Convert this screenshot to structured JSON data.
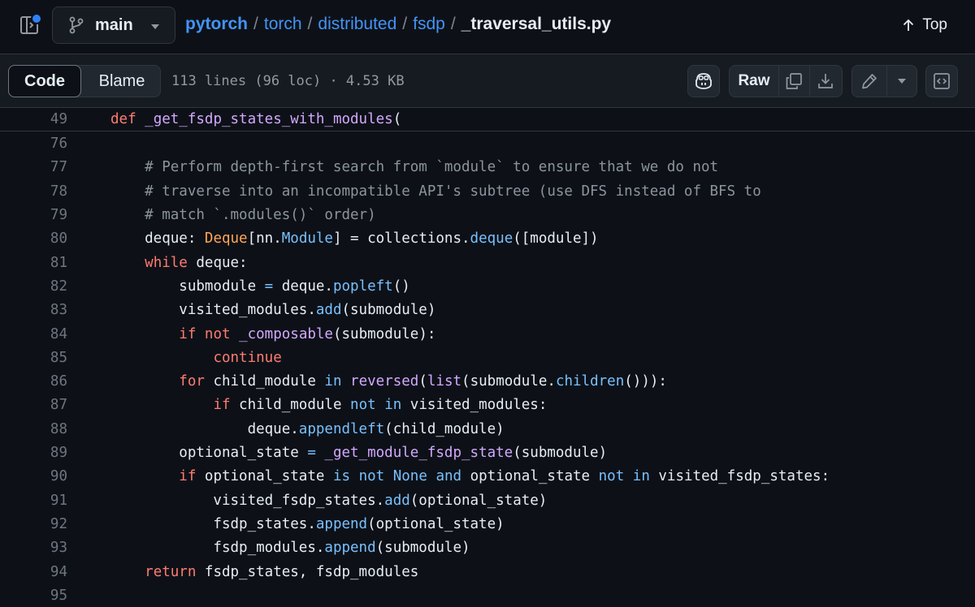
{
  "repo": {
    "branch": "main",
    "breadcrumb": [
      "pytorch",
      "torch",
      "distributed",
      "fsdp"
    ],
    "file_name": "_traversal_utils.py",
    "top_link": "Top"
  },
  "file_header": {
    "tabs": [
      "Code",
      "Blame"
    ],
    "active_tab": "Code",
    "meta": "113 lines (96 loc) · 4.53 KB",
    "raw_label": "Raw"
  },
  "colors": {
    "keyword": "#ff7b72",
    "function": "#d2a8ff",
    "method": "#79c0ff",
    "comment": "#8b949e",
    "type": "#ffa657",
    "link": "#4493f8",
    "notification_dot": "#2f81f7"
  },
  "icons": {
    "sidebar_toggle": "sidebar-expand-icon",
    "branch": "git-branch-icon",
    "top": "arrow-up-icon",
    "copilot": "copilot-icon",
    "copy": "copy-icon",
    "download": "download-icon",
    "edit": "pencil-icon",
    "edit_menu": "triangle-down-icon",
    "symbols": "code-square-icon"
  },
  "code": {
    "sticky": {
      "number": "49",
      "tokens": [
        {
          "t": "def",
          "c": "kw"
        },
        {
          "t": " ",
          "c": ""
        },
        {
          "t": "_get_fsdp_states_with_modules",
          "c": "fn"
        },
        {
          "t": "(",
          "c": ""
        }
      ]
    },
    "lines": [
      {
        "number": "76",
        "tokens": []
      },
      {
        "number": "77",
        "tokens": [
          {
            "t": "    # Perform depth-first search from `module` to ensure that we do not",
            "c": "cm"
          }
        ]
      },
      {
        "number": "78",
        "tokens": [
          {
            "t": "    # traverse into an incompatible API's subtree (use DFS instead of BFS to",
            "c": "cm"
          }
        ]
      },
      {
        "number": "79",
        "tokens": [
          {
            "t": "    # match `.modules()` order)",
            "c": "cm"
          }
        ]
      },
      {
        "number": "80",
        "tokens": [
          {
            "t": "    deque: ",
            "c": ""
          },
          {
            "t": "Deque",
            "c": "ty"
          },
          {
            "t": "[nn.",
            "c": ""
          },
          {
            "t": "Module",
            "c": "mt"
          },
          {
            "t": "] = collections.",
            "c": ""
          },
          {
            "t": "deque",
            "c": "mt"
          },
          {
            "t": "([module])",
            "c": ""
          }
        ]
      },
      {
        "number": "81",
        "tokens": [
          {
            "t": "    ",
            "c": ""
          },
          {
            "t": "while",
            "c": "kw"
          },
          {
            "t": " deque:",
            "c": ""
          }
        ]
      },
      {
        "number": "82",
        "tokens": [
          {
            "t": "        submodule ",
            "c": ""
          },
          {
            "t": "=",
            "c": "mt"
          },
          {
            "t": " deque.",
            "c": ""
          },
          {
            "t": "popleft",
            "c": "mt"
          },
          {
            "t": "()",
            "c": ""
          }
        ]
      },
      {
        "number": "83",
        "tokens": [
          {
            "t": "        visited_modules.",
            "c": ""
          },
          {
            "t": "add",
            "c": "mt"
          },
          {
            "t": "(submodule)",
            "c": ""
          }
        ]
      },
      {
        "number": "84",
        "tokens": [
          {
            "t": "        ",
            "c": ""
          },
          {
            "t": "if",
            "c": "kw"
          },
          {
            "t": " ",
            "c": ""
          },
          {
            "t": "not",
            "c": "kw"
          },
          {
            "t": " ",
            "c": ""
          },
          {
            "t": "_composable",
            "c": "fn"
          },
          {
            "t": "(submodule):",
            "c": ""
          }
        ]
      },
      {
        "number": "85",
        "tokens": [
          {
            "t": "            ",
            "c": ""
          },
          {
            "t": "continue",
            "c": "kw"
          }
        ]
      },
      {
        "number": "86",
        "tokens": [
          {
            "t": "        ",
            "c": ""
          },
          {
            "t": "for",
            "c": "kw"
          },
          {
            "t": " child_module ",
            "c": ""
          },
          {
            "t": "in",
            "c": "mt"
          },
          {
            "t": " ",
            "c": ""
          },
          {
            "t": "reversed",
            "c": "fn"
          },
          {
            "t": "(",
            "c": ""
          },
          {
            "t": "list",
            "c": "fn"
          },
          {
            "t": "(submodule.",
            "c": ""
          },
          {
            "t": "children",
            "c": "mt"
          },
          {
            "t": "())):",
            "c": ""
          }
        ]
      },
      {
        "number": "87",
        "tokens": [
          {
            "t": "            ",
            "c": ""
          },
          {
            "t": "if",
            "c": "kw"
          },
          {
            "t": " child_module ",
            "c": ""
          },
          {
            "t": "not",
            "c": "mt"
          },
          {
            "t": " ",
            "c": ""
          },
          {
            "t": "in",
            "c": "mt"
          },
          {
            "t": " visited_modules:",
            "c": ""
          }
        ]
      },
      {
        "number": "88",
        "tokens": [
          {
            "t": "                deque.",
            "c": ""
          },
          {
            "t": "appendleft",
            "c": "mt"
          },
          {
            "t": "(child_module)",
            "c": ""
          }
        ]
      },
      {
        "number": "89",
        "tokens": [
          {
            "t": "        optional_state ",
            "c": ""
          },
          {
            "t": "=",
            "c": "mt"
          },
          {
            "t": " ",
            "c": ""
          },
          {
            "t": "_get_module_fsdp_state",
            "c": "fn"
          },
          {
            "t": "(submodule)",
            "c": ""
          }
        ]
      },
      {
        "number": "90",
        "tokens": [
          {
            "t": "        ",
            "c": ""
          },
          {
            "t": "if",
            "c": "kw"
          },
          {
            "t": " optional_state ",
            "c": ""
          },
          {
            "t": "is",
            "c": "mt"
          },
          {
            "t": " ",
            "c": ""
          },
          {
            "t": "not",
            "c": "mt"
          },
          {
            "t": " ",
            "c": ""
          },
          {
            "t": "None",
            "c": "mt"
          },
          {
            "t": " ",
            "c": ""
          },
          {
            "t": "and",
            "c": "mt"
          },
          {
            "t": " optional_state ",
            "c": ""
          },
          {
            "t": "not",
            "c": "mt"
          },
          {
            "t": " ",
            "c": ""
          },
          {
            "t": "in",
            "c": "mt"
          },
          {
            "t": " visited_fsdp_states:",
            "c": ""
          }
        ]
      },
      {
        "number": "91",
        "tokens": [
          {
            "t": "            visited_fsdp_states.",
            "c": ""
          },
          {
            "t": "add",
            "c": "mt"
          },
          {
            "t": "(optional_state)",
            "c": ""
          }
        ]
      },
      {
        "number": "92",
        "tokens": [
          {
            "t": "            fsdp_states.",
            "c": ""
          },
          {
            "t": "append",
            "c": "mt"
          },
          {
            "t": "(optional_state)",
            "c": ""
          }
        ]
      },
      {
        "number": "93",
        "tokens": [
          {
            "t": "            fsdp_modules.",
            "c": ""
          },
          {
            "t": "append",
            "c": "mt"
          },
          {
            "t": "(submodule)",
            "c": ""
          }
        ]
      },
      {
        "number": "94",
        "tokens": [
          {
            "t": "    ",
            "c": ""
          },
          {
            "t": "return",
            "c": "kw"
          },
          {
            "t": " fsdp_states, fsdp_modules",
            "c": ""
          }
        ]
      },
      {
        "number": "95",
        "tokens": []
      }
    ]
  }
}
